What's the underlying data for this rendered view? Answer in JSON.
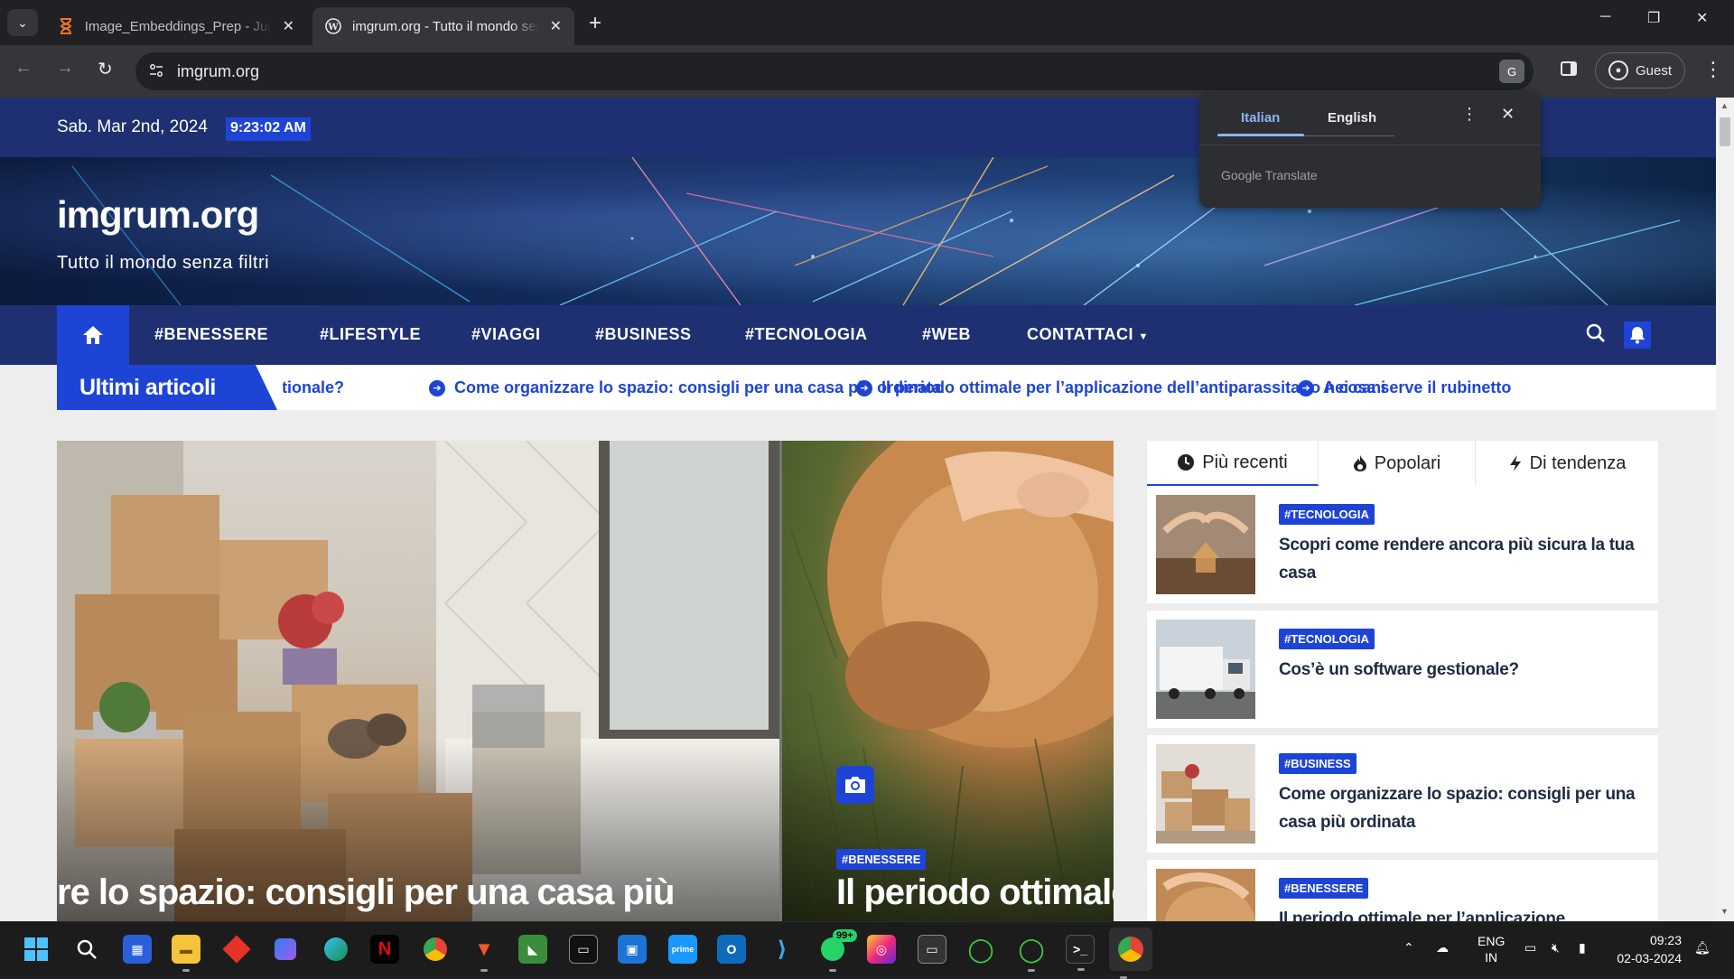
{
  "browser": {
    "tabs": [
      {
        "title": "Image_Embeddings_Prep - Jupyter",
        "icon": "jupyter-hourglass-icon"
      },
      {
        "title": "imgrum.org - Tutto il mondo senza filtri",
        "icon": "wordpress-icon"
      }
    ],
    "url": "imgrum.org",
    "profile_label": "Guest"
  },
  "translate_popup": {
    "languages": [
      "Italian",
      "English"
    ],
    "active": "Italian",
    "footer": "Google Translate"
  },
  "site": {
    "date": "Sab. Mar 2nd, 2024",
    "clock": "9:23:02 AM",
    "title": "imgrum.org",
    "tagline": "Tutto il mondo senza filtri",
    "nav": [
      "#BENESSERE",
      "#LIFESTYLE",
      "#VIAGGI",
      "#BUSINESS",
      "#TECNOLOGIA",
      "#WEB",
      "CONTATTACI"
    ],
    "ticker_label": "Ultimi articoli",
    "ticker": [
      "Cos’è un software gestionale?",
      "Come organizzare lo spazio: consigli per una casa più ordinata",
      "Il periodo ottimale per l’applicazione dell’antiparassitario nei cani",
      "A cosa serve il rubinetto"
    ]
  },
  "slider": [
    {
      "title": "re lo spazio: consigli per una casa più",
      "category": ""
    },
    {
      "title": "Il periodo ottimale per",
      "category": "#BENESSERE"
    }
  ],
  "sidebar": {
    "tabs": [
      {
        "label": "Più recenti",
        "icon": "clock-icon"
      },
      {
        "label": "Popolari",
        "icon": "fire-icon"
      },
      {
        "label": "Di tendenza",
        "icon": "bolt-icon"
      }
    ],
    "posts": [
      {
        "category": "#TECNOLOGIA",
        "title": "Scopri come rendere ancora più sicura la tua casa"
      },
      {
        "category": "#TECNOLOGIA",
        "title": "Cos’è un software gestionale?"
      },
      {
        "category": "#BUSINESS",
        "title": "Come organizzare lo spazio: consigli per una casa più ordinata"
      },
      {
        "category": "#BENESSERE",
        "title": "Il periodo ottimale per l’applicazione"
      }
    ]
  },
  "taskbar": {
    "whatsapp_badge": "99+",
    "lang": "ENG",
    "region": "IN",
    "time": "09:23",
    "date": "02-03-2024"
  },
  "colors": {
    "accent": "#1e44d6",
    "navy": "#1f3072",
    "chrome_dark": "#202124"
  }
}
